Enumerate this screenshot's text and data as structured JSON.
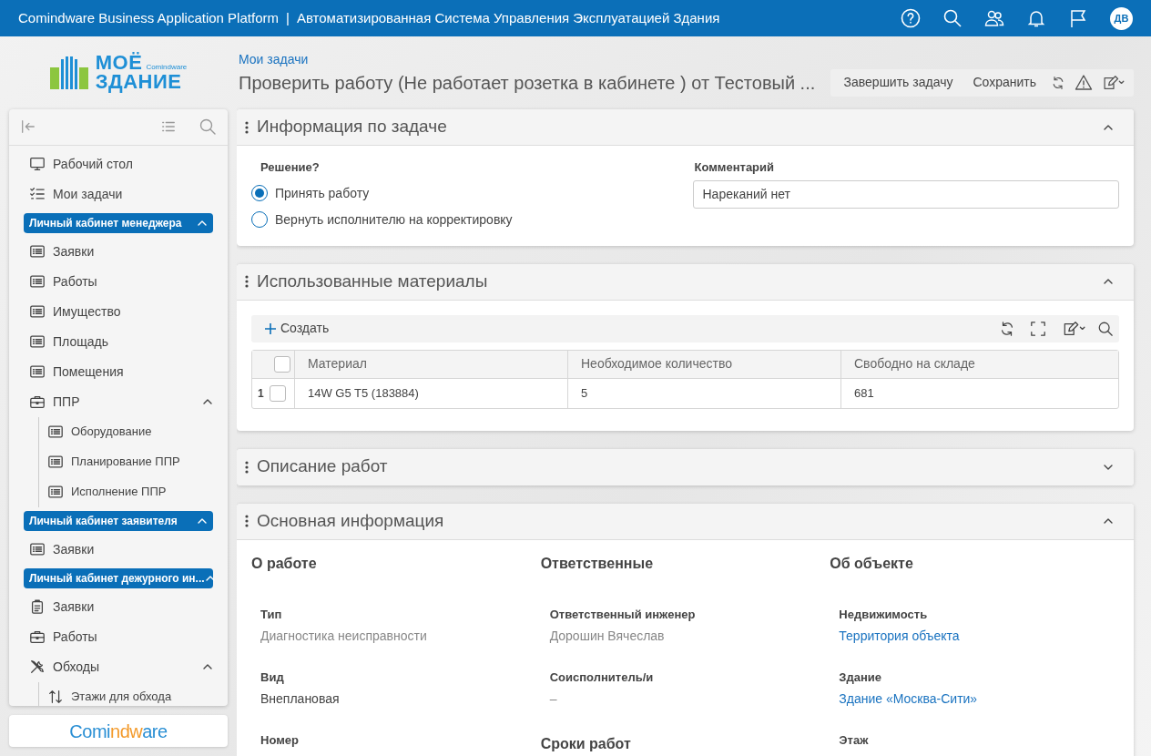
{
  "top_bar": {
    "brand": "Comindware Business Application Platform",
    "separator": "|",
    "title": "Автоматизированная Система Управления Эксплуатацией Здания",
    "avatar": "ДВ"
  },
  "logo": {
    "line_1": "МОЁ",
    "line_2": "ЗДАНИЕ",
    "maker": "Comindware"
  },
  "sidebar": {
    "items": [
      {
        "kind": "dashboard",
        "label": "Рабочий стол"
      },
      {
        "kind": "tasks",
        "label": "Мои задачи"
      },
      {
        "kind": "section",
        "label": "Личный кабинет менеджера",
        "expanded": true
      },
      {
        "kind": "table",
        "label": "Заявки"
      },
      {
        "kind": "table",
        "label": "Работы"
      },
      {
        "kind": "table",
        "label": "Имущество"
      },
      {
        "kind": "table",
        "label": "Площадь"
      },
      {
        "kind": "table",
        "label": "Помещения"
      },
      {
        "kind": "process",
        "label": "ППР",
        "expanded": true,
        "children": [
          {
            "kind": "table",
            "label": "Оборудование"
          },
          {
            "kind": "table",
            "label": "Планирование ППР"
          },
          {
            "kind": "table",
            "label": "Исполнение ППР"
          }
        ]
      },
      {
        "kind": "section",
        "label": "Личный кабинет заявителя",
        "expanded": true
      },
      {
        "kind": "table",
        "label": "Заявки"
      },
      {
        "kind": "section",
        "label": "Личный кабинет дежурного ин...",
        "expanded": true
      },
      {
        "kind": "form",
        "label": "Заявки"
      },
      {
        "kind": "process",
        "label": "Работы"
      },
      {
        "kind": "tour",
        "label": "Обходы",
        "expanded": true,
        "children": [
          {
            "kind": "ordering",
            "label": "Этажи для обхода"
          }
        ]
      }
    ]
  },
  "footer_logo": "Comindware",
  "breadcrumb": "Мои задачи",
  "page_title": "Проверить работу (Не работает розетка в кабинете ) от Тестовый ...",
  "actions": [
    "Завершить задачу",
    "Сохранить"
  ],
  "panels": [
    {
      "kind": "decision",
      "title": "Информация по задаче",
      "expanded": true,
      "question": "Решение?",
      "options": [
        {
          "label": "Принять работу",
          "selected": true
        },
        {
          "label": "Вернуть исполнителю на корректировку",
          "selected": false
        }
      ],
      "comment_label": "Комментарий",
      "comment": "Нареканий нет"
    },
    {
      "kind": "materials",
      "title": "Использованные материалы",
      "expanded": true,
      "create": "Создать",
      "select_all_checked": false,
      "columns": [
        "Материал",
        "Необходимое количество",
        "Свободно на складе"
      ],
      "rows": [
        {
          "number": "1",
          "checked": false,
          "cells": [
            "14W G5 T5 (183884)",
            "5",
            "681"
          ]
        }
      ]
    },
    {
      "title": "Описание работ",
      "expanded": false
    },
    {
      "kind": "details",
      "title": "Основная информация",
      "expanded": true,
      "columns": [
        {
          "heading": "О работе",
          "entries": [
            {
              "kind": "muted",
              "label": "Тип",
              "value": "Диагностика неисправности"
            },
            {
              "kind": "plain",
              "label": "Вид",
              "value": "Внеплановая"
            },
            {
              "kind": "label",
              "label": "Номер"
            }
          ]
        },
        {
          "heading": "Ответственные",
          "entries": [
            {
              "kind": "muted",
              "label": "Ответственный инженер",
              "value": "Дорошин Вячеслав"
            },
            {
              "kind": "muted",
              "label": "Соисполнитель/и",
              "value": "–"
            },
            {
              "kind": "heading",
              "text": "Сроки работ"
            }
          ]
        },
        {
          "heading": "Об объекте",
          "entries": [
            {
              "kind": "link",
              "label": "Недвижимость",
              "value": "Территория объекта"
            },
            {
              "kind": "link",
              "label": "Здание",
              "value": "Здание «Москва-Сити»"
            },
            {
              "kind": "label",
              "label": "Этаж"
            }
          ]
        }
      ]
    }
  ]
}
